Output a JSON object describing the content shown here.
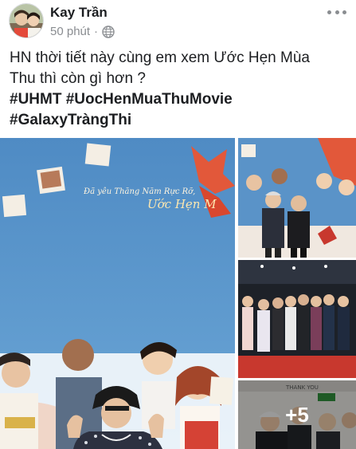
{
  "post": {
    "author": "Kay Trần",
    "time": "50 phút",
    "separator": "·",
    "text_line1": "HN thời tiết này cùng em xem Ước Hẹn Mùa",
    "text_line2": "Thu thì còn gì hơn ?",
    "hashtags_line1": "#UHMT #UocHenMuaThuMovie",
    "hashtags_line2": "#GalaxyTràngThi"
  },
  "media": {
    "more_count": "+5",
    "banner_script": "Đã yêu Thăng Năm Rực Rỡ,",
    "banner_title": "Ước Hẹn M",
    "sign_text": "THANK YOU"
  },
  "icons": {
    "privacy": "globe-icon",
    "menu": "more-options-icon"
  },
  "colors": {
    "name": "#1c1e21",
    "meta": "#8a8d91",
    "backdrop_blue": "#5b95c9",
    "stage_red": "#c8382e"
  }
}
